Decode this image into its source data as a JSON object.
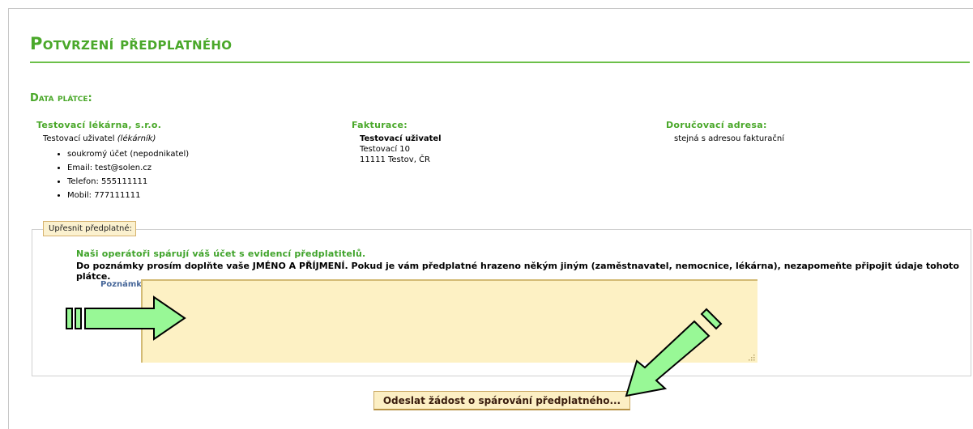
{
  "page": {
    "title": "Potvrzení předplatného"
  },
  "payer_section": {
    "title": "Data plátce:"
  },
  "payer": {
    "name": "Testovací lékárna, s.r.o.",
    "user": "Testovací uživatel",
    "role": "(lékárník)",
    "details": [
      "soukromý účet (nepodnikatel)",
      "Email: test@solen.cz",
      "Telefon: 555111111",
      "Mobil: 777111111"
    ]
  },
  "billing": {
    "heading": "Fakturace:",
    "name": "Testovací uživatel",
    "street": "Testovací 10",
    "city": "11111 Testov, ČR"
  },
  "delivery": {
    "heading": "Doručovací adresa:",
    "text": "stejná s adresou fakturační"
  },
  "refine": {
    "legend": "Upřesnit předplatné:",
    "info_green": "Naši operátoři spárují váš účet s evidencí předplatitelů.",
    "info_black": "Do poznámky prosím doplňte vaše JMÉNO A PŘÍJMENÍ. Pokud je vám předplatné hrazeno někým jiným (zaměstnavatel, nemocnice, lékárna), nezapomeňte připojit údaje tohoto plátce.",
    "note_label": "Poznámka:",
    "note_value": ""
  },
  "submit": {
    "label": "Odeslat žádost o spárování předplatného..."
  },
  "colors": {
    "accent_green": "#4aa82a",
    "arrow_fill": "#98f896",
    "field_bg": "#fdf1c4"
  },
  "icons": [
    "right-arrow-icon",
    "diagonal-arrow-icon",
    "resize-grip-icon"
  ]
}
